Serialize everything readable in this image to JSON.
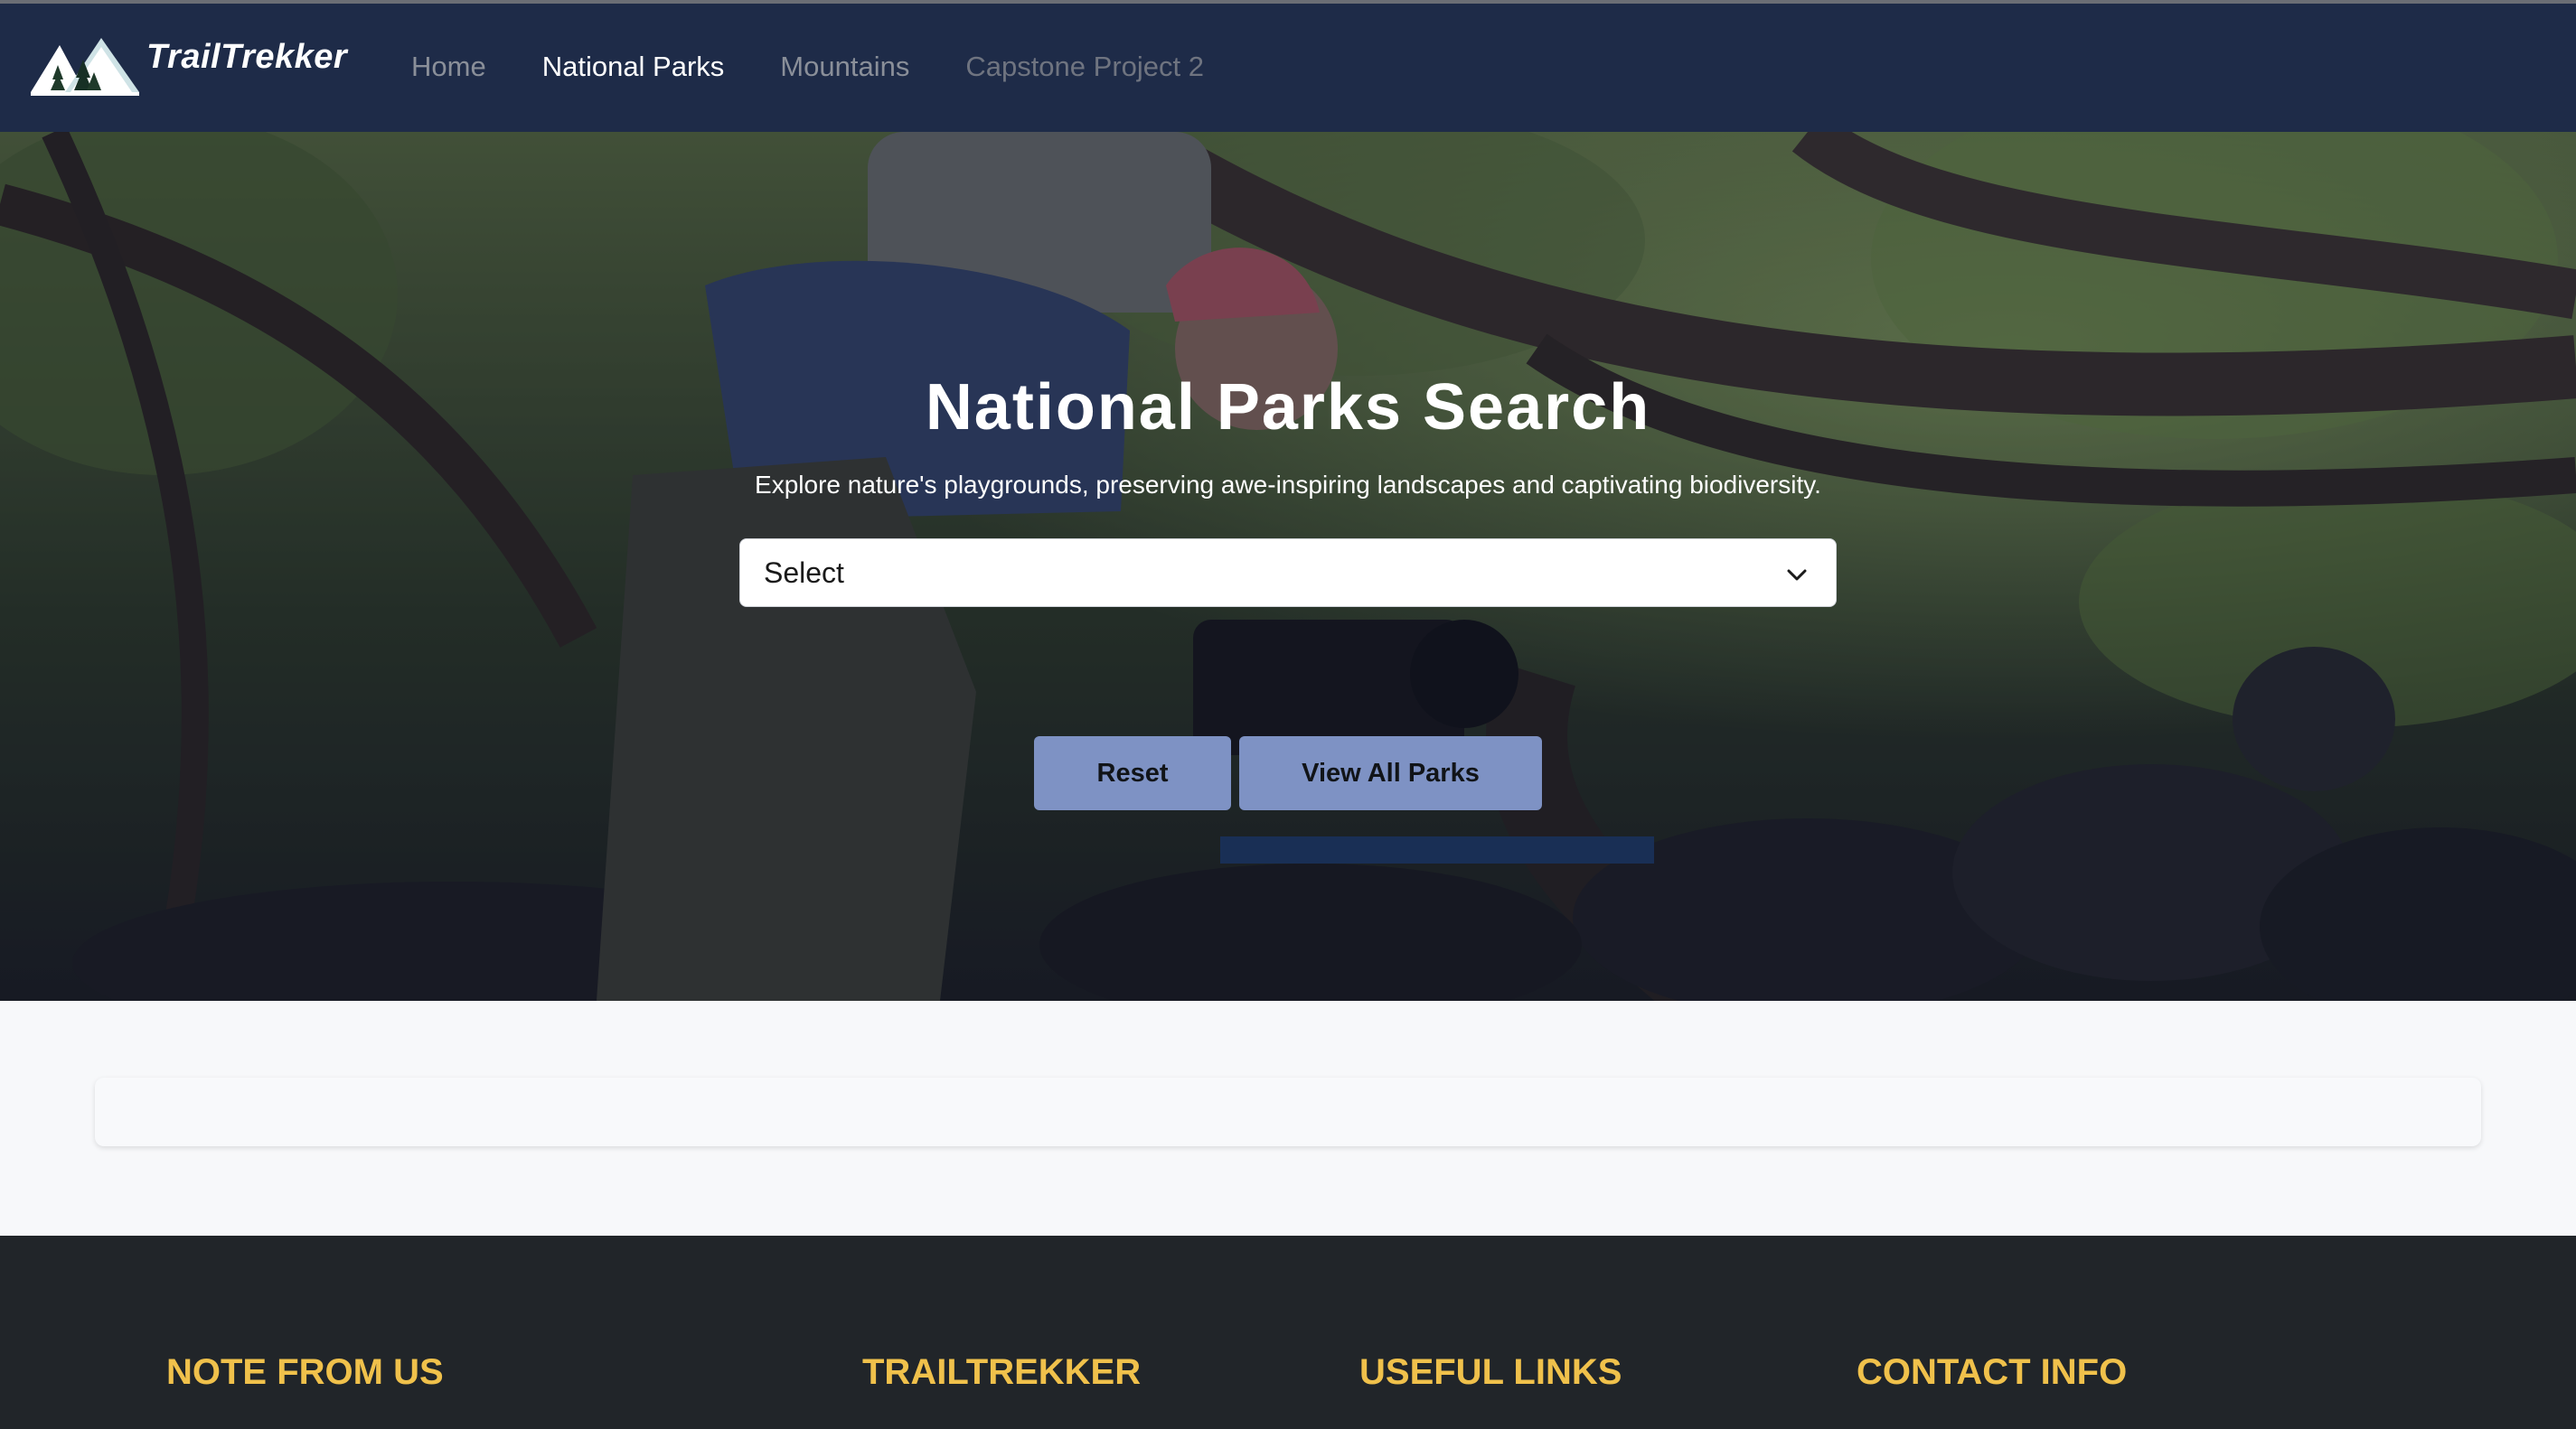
{
  "navbar": {
    "brand": "TrailTrekker",
    "links": [
      {
        "label": "Home",
        "state": "inactive"
      },
      {
        "label": "National Parks",
        "state": "active"
      },
      {
        "label": "Mountains",
        "state": "inactive"
      },
      {
        "label": "Capstone Project 2",
        "state": "inactive"
      }
    ]
  },
  "hero": {
    "title": "National Parks Search",
    "subtitle": "Explore nature's playgrounds, preserving awe-inspiring landscapes and captivating biodiversity.",
    "select": {
      "value": "Select"
    },
    "buttons": {
      "reset": "Reset",
      "view_all": "View All Parks"
    }
  },
  "footer": {
    "headings": [
      "NOTE FROM US",
      "TRAILTREKKER",
      "USEFUL LINKS",
      "CONTACT INFO"
    ]
  },
  "colors": {
    "navbar_bg": "#1e2b48",
    "button_bg": "#7e92c4",
    "footer_bg": "#212529",
    "footer_heading": "#f0c14b"
  },
  "icons": {
    "logo": "mountains-trees-logo-icon",
    "select_arrow": "chevron-down-icon"
  }
}
